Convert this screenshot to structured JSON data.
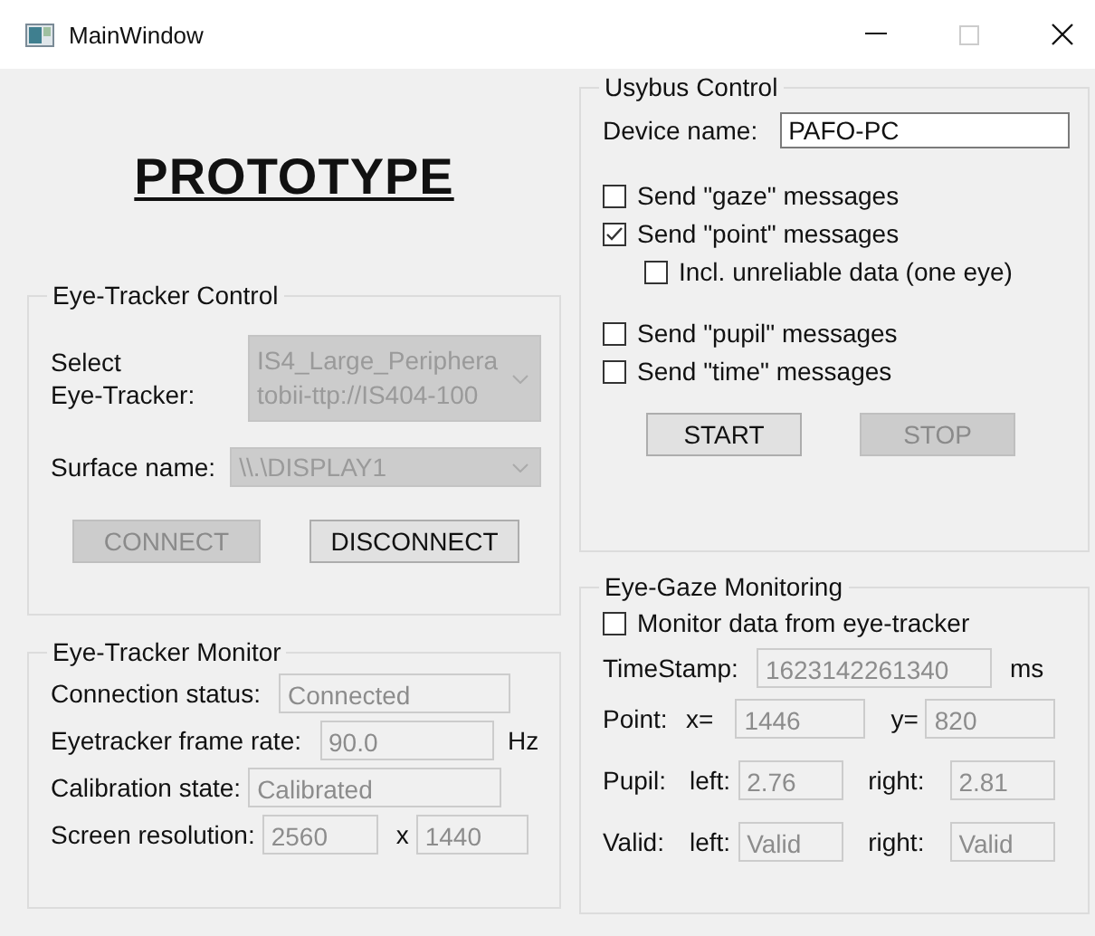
{
  "window": {
    "title": "MainWindow",
    "maximize_enabled": false
  },
  "heading": "PROTOTYPE",
  "eye_tracker_control": {
    "title": "Eye-Tracker Control",
    "select_label": [
      "Select",
      "Eye-Tracker:"
    ],
    "tracker_combo": {
      "lines": [
        "IS4_Large_Periphera",
        "tobii-ttp://IS404-100"
      ],
      "disabled": true
    },
    "surface_label": "Surface name:",
    "surface_combo": {
      "value": "\\\\.\\DISPLAY1",
      "disabled": true
    },
    "buttons": [
      {
        "label": "CONNECT",
        "disabled": true
      },
      {
        "label": "DISCONNECT",
        "disabled": false
      }
    ]
  },
  "eye_tracker_monitor": {
    "title": "Eye-Tracker Monitor",
    "rows": [
      {
        "label": "Connection status:",
        "fields": [
          {
            "value": "Connected",
            "disabled": true
          }
        ]
      },
      {
        "label": "Eyetracker frame rate:",
        "fields": [
          {
            "value": "90.0",
            "disabled": true,
            "suffix": "Hz"
          }
        ]
      },
      {
        "label": "Calibration state:",
        "fields": [
          {
            "value": "Calibrated",
            "disabled": true
          }
        ]
      },
      {
        "label": "Screen resolution:",
        "fields": [
          {
            "value": "2560",
            "disabled": true,
            "suffix": "x"
          },
          {
            "value": "1440",
            "disabled": true
          }
        ]
      }
    ]
  },
  "usybus_control": {
    "title": "Usybus Control",
    "device_label": "Device name:",
    "device_name": {
      "value": "PAFO-PC",
      "disabled": false
    },
    "checkboxes": [
      {
        "label": "Send \"gaze\" messages",
        "checked": false
      },
      {
        "label": "Send \"point\" messages",
        "checked": true,
        "children": [
          {
            "label": "Incl. unreliable data (one eye)",
            "checked": false
          }
        ]
      },
      {
        "label": "Send \"pupil\" messages",
        "checked": false
      },
      {
        "label": "Send \"time\" messages",
        "checked": false
      }
    ],
    "buttons": [
      {
        "label": "START",
        "disabled": false
      },
      {
        "label": "STOP",
        "disabled": true
      }
    ]
  },
  "eye_gaze_monitoring": {
    "title": "Eye-Gaze Monitoring",
    "monitor_checkbox": {
      "label": "Monitor data from eye-tracker",
      "checked": false
    },
    "rows": [
      {
        "label": "TimeStamp:",
        "fields": [
          {
            "value": "1623142261340",
            "disabled": true,
            "suffix": "ms"
          }
        ]
      },
      {
        "label": "Point:",
        "fields": [
          {
            "prefix": "x=",
            "value": "1446",
            "disabled": true
          },
          {
            "prefix": "y=",
            "value": "820",
            "disabled": true
          }
        ]
      },
      {
        "label": "Pupil:",
        "fields": [
          {
            "prefix": "left:",
            "value": "2.76",
            "disabled": true
          },
          {
            "prefix": "right:",
            "value": "2.81",
            "disabled": true
          }
        ]
      },
      {
        "label": "Valid:",
        "fields": [
          {
            "prefix": "left:",
            "value": "Valid",
            "disabled": true
          },
          {
            "prefix": "right:",
            "value": "Valid",
            "disabled": true
          }
        ]
      }
    ]
  }
}
